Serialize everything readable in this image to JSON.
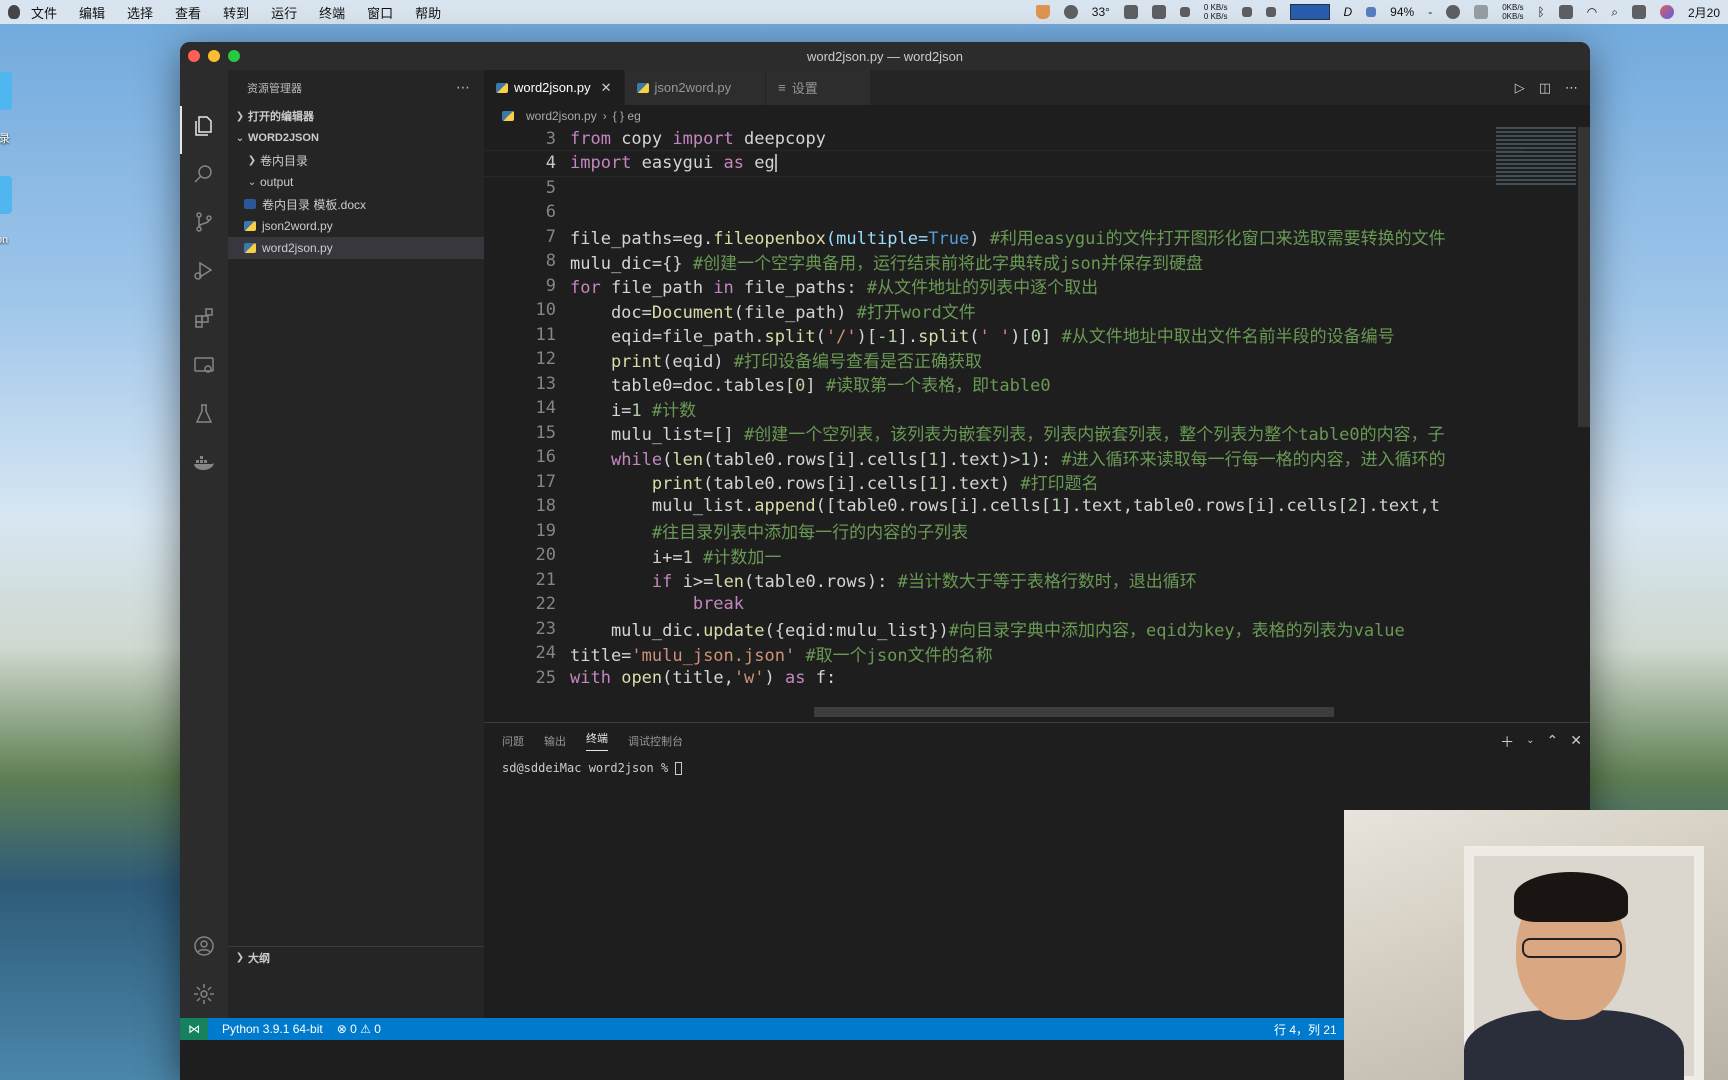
{
  "menubar": {
    "items": [
      "文件",
      "编辑",
      "选择",
      "查看",
      "转到",
      "运行",
      "终端",
      "窗口",
      "帮助"
    ],
    "temperature": "33°",
    "net_up": "0 KB/s",
    "net_down": "0 KB/s",
    "disk_label": "D",
    "battery": "94%",
    "net2_up": "0KB/s",
    "net2_down": "0KB/s",
    "date": "2月20"
  },
  "desktop": {
    "icon1_label": "记录",
    "icon2_label": "json"
  },
  "window": {
    "title": "word2json.py — word2json"
  },
  "sidebar": {
    "title": "资源管理器",
    "open_editors": "打开的编辑器",
    "project": "WORD2JSON",
    "tree": [
      {
        "label": "卷内目录",
        "kind": "folder-collapsed"
      },
      {
        "label": "output",
        "kind": "folder-open"
      },
      {
        "label": "卷内目录 模板.docx",
        "kind": "doc"
      },
      {
        "label": "json2word.py",
        "kind": "py"
      },
      {
        "label": "word2json.py",
        "kind": "py",
        "selected": true
      }
    ],
    "outline": "大纲"
  },
  "tabs": [
    {
      "label": "word2json.py",
      "active": true
    },
    {
      "label": "json2word.py",
      "active": false
    },
    {
      "label": "设置",
      "active": false
    }
  ],
  "breadcrumb": {
    "file": "word2json.py",
    "symbol": "{ } eg"
  },
  "code": {
    "current_line": 4,
    "lines": [
      {
        "n": "3"
      },
      {
        "n": "4"
      },
      {
        "n": "5"
      },
      {
        "n": "6"
      },
      {
        "n": "7"
      },
      {
        "n": "8"
      },
      {
        "n": "9"
      },
      {
        "n": "10"
      },
      {
        "n": "11"
      },
      {
        "n": "12"
      },
      {
        "n": "13"
      },
      {
        "n": "14"
      },
      {
        "n": "15"
      },
      {
        "n": "16"
      },
      {
        "n": "17"
      },
      {
        "n": "18"
      },
      {
        "n": "19"
      },
      {
        "n": "20"
      },
      {
        "n": "21"
      },
      {
        "n": "22"
      },
      {
        "n": "23"
      },
      {
        "n": "24"
      },
      {
        "n": "25"
      }
    ],
    "tokens": {
      "l3": [
        "from",
        " copy ",
        "import",
        " deepcopy"
      ],
      "l4": [
        "import",
        " easygui ",
        "as",
        " eg"
      ],
      "l7": [
        "file_paths=eg.",
        "fileopenbox",
        "(multiple=",
        "True",
        ") ",
        "#利用easygui的文件打开图形化窗口来选取需要转换的文件"
      ],
      "l8": [
        "mulu_dic={} ",
        "#创建一个空字典备用，运行结束前将此字典转成json并保存到硬盘"
      ],
      "l9": [
        "for",
        " file_path ",
        "in",
        " file_paths: ",
        "#从文件地址的列表中逐个取出"
      ],
      "l10": [
        "    doc=",
        "Document",
        "(file_path) ",
        "#打开word文件"
      ],
      "l11": [
        "    eqid=file_path.",
        "split",
        "(",
        "'/'",
        ")[",
        "-1",
        "].",
        "split",
        "(",
        "' '",
        ")[",
        "0",
        "] ",
        "#从文件地址中取出文件名前半段的设备编号"
      ],
      "l12": [
        "    ",
        "print",
        "(eqid) ",
        "#打印设备编号查看是否正确获取"
      ],
      "l13": [
        "    table0=doc.tables[",
        "0",
        "] ",
        "#读取第一个表格，即table0"
      ],
      "l14": [
        "    i=",
        "1",
        " ",
        "#计数"
      ],
      "l15": [
        "    mulu_list=[] ",
        "#创建一个空列表，该列表为嵌套列表，列表内嵌套列表，整个列表为整个table0的内容，子"
      ],
      "l16": [
        "    ",
        "while",
        "(",
        "len",
        "(table0.rows[i].cells[",
        "1",
        "].text)>",
        "1",
        "): ",
        "#进入循环来读取每一行每一格的内容，进入循环的"
      ],
      "l17": [
        "        ",
        "print",
        "(table0.rows[i].cells[",
        "1",
        "].text) ",
        "#打印题名"
      ],
      "l18": [
        "        mulu_list.",
        "append",
        "([table0.rows[i].cells[",
        "1",
        "].text,table0.rows[i].cells[",
        "2",
        "].text,t"
      ],
      "l19": [
        "        ",
        "#往目录列表中添加每一行的内容的子列表"
      ],
      "l20": [
        "        i+=",
        "1",
        " ",
        "#计数加一"
      ],
      "l21": [
        "        ",
        "if",
        " i>=",
        "len",
        "(table0.rows): ",
        "#当计数大于等于表格行数时，退出循环"
      ],
      "l22": [
        "            ",
        "break"
      ],
      "l23": [
        "    mulu_dic.",
        "update",
        "({eqid:mulu_list})",
        "#向目录字典中添加内容，eqid为key，表格的列表为value"
      ],
      "l24": [
        "title=",
        "'mulu_json.json'",
        " ",
        "#取一个json文件的名称"
      ],
      "l25": [
        "with",
        " ",
        "open",
        "(title,",
        "'w'",
        ") ",
        "as",
        " f:"
      ]
    }
  },
  "panel": {
    "tabs": [
      "问题",
      "输出",
      "终端",
      "调试控制台"
    ],
    "active_tab": "终端",
    "prompt": "sd@sddeiMac word2json % ",
    "shell": "zsh"
  },
  "statusbar": {
    "python": "Python 3.9.1 64-bit",
    "errors": "0",
    "warnings": "0",
    "cursor_pos": "行 4，列 21"
  },
  "colors": {
    "accent": "#007acc",
    "keyword": "#569cd6",
    "control": "#c586c0",
    "function": "#dcdcaa",
    "string": "#ce9178",
    "comment": "#6a9955",
    "number": "#b5cea8"
  }
}
